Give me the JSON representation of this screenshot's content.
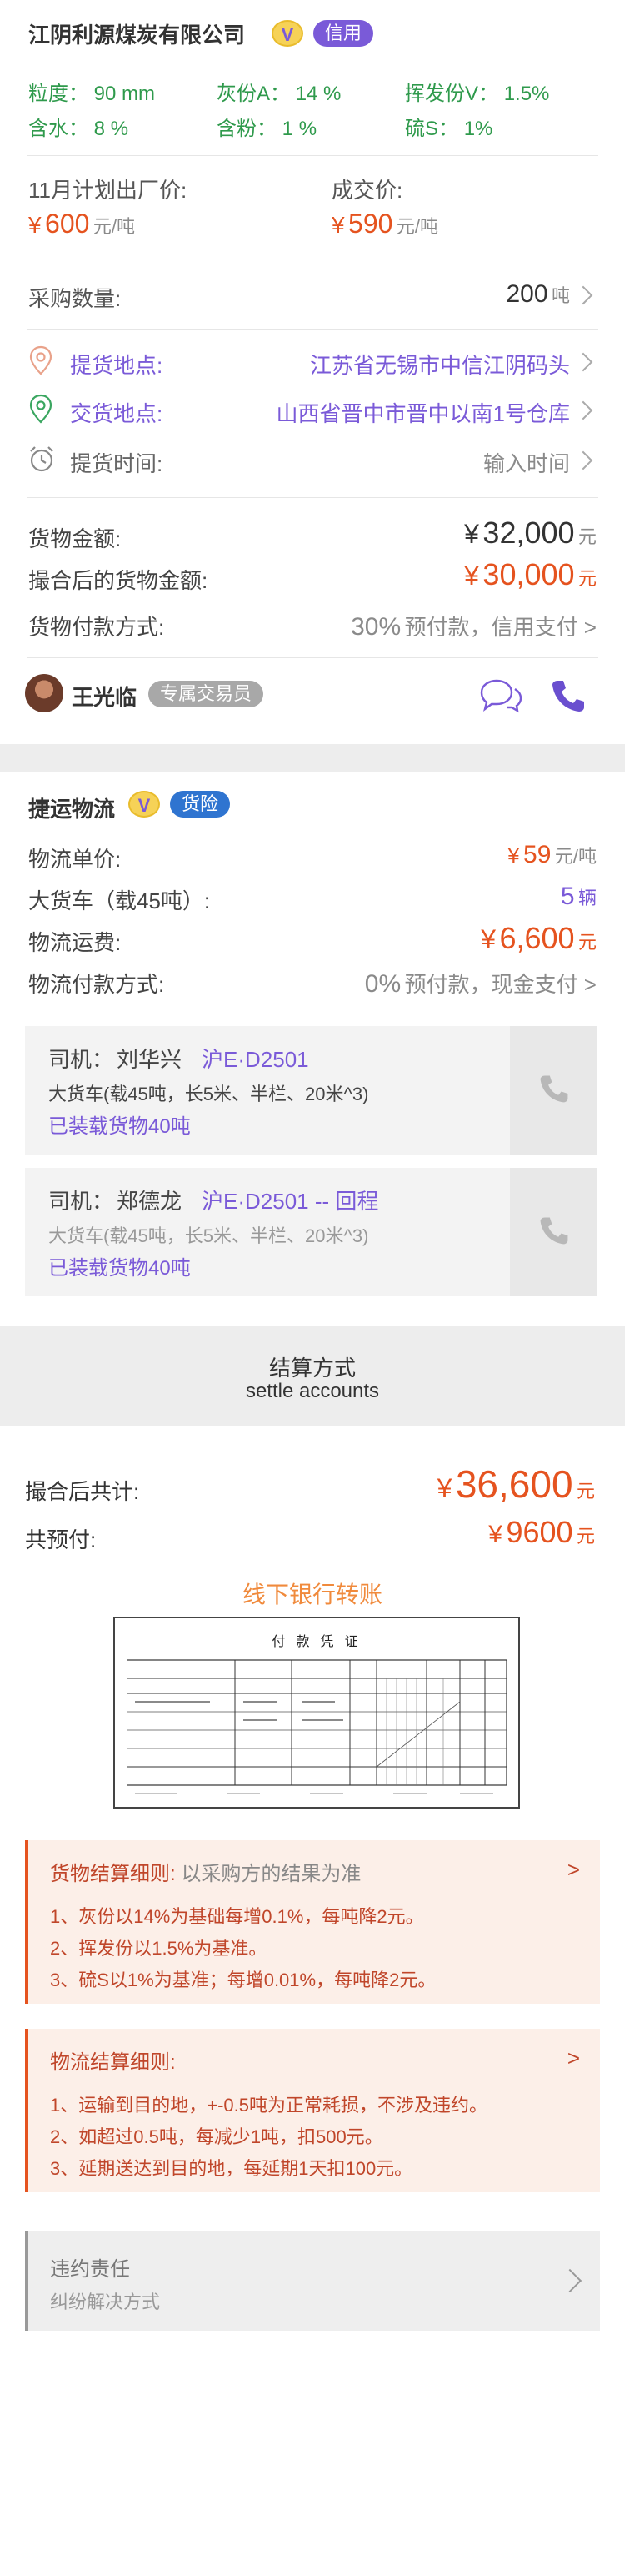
{
  "company": {
    "name": "江阴利源煤炭有限公司",
    "v_badge": "V",
    "tag": "信用"
  },
  "specs": {
    "granularity_label": "粒度：",
    "granularity": "90 mm",
    "ash_label": "灰份A：",
    "ash": "14 %",
    "volatile_label": "挥发份V：",
    "volatile": "1.5%",
    "water_label": "含水：",
    "water": "8 %",
    "powder_label": "含粉：",
    "powder": "1 %",
    "sulfur_label": "硫S：",
    "sulfur": "1%"
  },
  "prices": {
    "plan_label": "11月计划出厂价:",
    "plan_symbol": "¥",
    "plan_value": "600",
    "plan_unit": "元/吨",
    "deal_label": "成交价:",
    "deal_symbol": "¥",
    "deal_value": "590",
    "deal_unit": "元/吨"
  },
  "purchase": {
    "label": "采购数量:",
    "value": "200",
    "unit": "吨"
  },
  "pickup": {
    "label": "提货地点:",
    "value": "江苏省无锡市中信江阴码头"
  },
  "delivery": {
    "label": "交货地点:",
    "value": "山西省晋中市晋中以南1号仓库"
  },
  "pickup_time": {
    "label": "提货时间:",
    "placeholder": "输入时间"
  },
  "amounts": {
    "goods_label": "货物金额:",
    "goods_symbol": "¥",
    "goods_value": "32,000",
    "goods_unit": "元",
    "matched_label": "撮合后的货物金额:",
    "matched_symbol": "¥",
    "matched_value": "30,000",
    "matched_unit": "元",
    "pay_label": "货物付款方式:",
    "pay_percent": "30%",
    "pay_text": "预付款，信用支付 >"
  },
  "agent": {
    "name": "王光临",
    "role": "专属交易员"
  },
  "logistics": {
    "name": "捷运物流",
    "v_badge": "V",
    "tag": "货险",
    "unit_price_label": "物流单价:",
    "unit_price_symbol": "¥",
    "unit_price": "59",
    "unit_price_unit": "元/吨",
    "truck_label": "大货车（载45吨）:",
    "truck_count": "5",
    "truck_unit": "辆",
    "fee_label": "物流运费:",
    "fee_symbol": "¥",
    "fee": "6,600",
    "fee_unit": "元",
    "pay_label": "物流付款方式:",
    "pay_percent": "0%",
    "pay_text": "预付款，现金支付 >"
  },
  "drivers": [
    {
      "label": "司机：",
      "name": "刘华兴",
      "plate": "沪E·D2501",
      "truck": "大货车(载45吨，长5米、半栏、20米^3)",
      "status": "已装载货物40吨"
    },
    {
      "label": "司机：",
      "name": "郑德龙",
      "plate": "沪E·D2501 -- 回程",
      "truck": "大货车(载45吨，长5米、半栏、20米^3)",
      "status": "已装载货物40吨"
    }
  ],
  "settle": {
    "title": "结算方式",
    "subtitle": "settle accounts"
  },
  "totals": {
    "matched_label": "撮合后共计:",
    "matched_symbol": "¥",
    "matched_value": "36,600",
    "matched_unit": "元",
    "prepay_label": "共预付:",
    "prepay_symbol": "¥",
    "prepay_value": "9600",
    "prepay_unit": "元"
  },
  "transfer": {
    "title": "线下银行转账"
  },
  "voucher": {
    "title": "付 款 凭 证"
  },
  "goods_rules": {
    "title": "货物结算细则:",
    "subtitle": "以采购方的结果为准",
    "arrow": ">",
    "items": [
      "1、灰份以14%为基础每增0.1%，每吨降2元。",
      "2、挥发份以1.5%为基准。",
      "3、硫S以1%为基准；每增0.01%，每吨降2元。"
    ]
  },
  "logistics_rules": {
    "title": "物流结算细则:",
    "arrow": ">",
    "items": [
      "1、运输到目的地，+-0.5吨为正常耗损，不涉及违约。",
      "2、如超过0.5吨，每减少1吨，扣500元。",
      "3、延期送达到目的地，每延期1天扣100元。"
    ]
  },
  "breach": {
    "title": "违约责任",
    "subtitle": "纠纷解决方式"
  }
}
